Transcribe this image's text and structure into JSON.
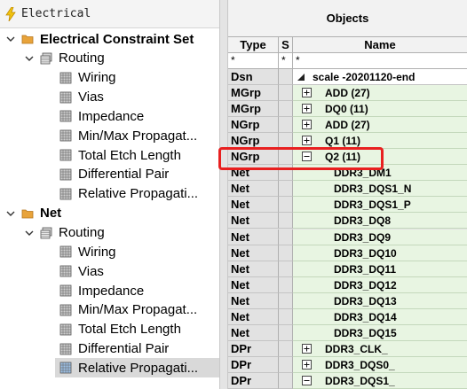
{
  "left_panel": {
    "header_title": "Electrical",
    "tree": [
      {
        "label": "Electrical Constraint Set",
        "level": 0,
        "expanded": true,
        "kind": "folder",
        "bold": true
      },
      {
        "label": "Routing",
        "level": 1,
        "expanded": true,
        "kind": "worksheet-group"
      },
      {
        "label": "Wiring",
        "level": 2,
        "kind": "worksheet"
      },
      {
        "label": "Vias",
        "level": 2,
        "kind": "worksheet"
      },
      {
        "label": "Impedance",
        "level": 2,
        "kind": "worksheet"
      },
      {
        "label": "Min/Max Propagat...",
        "level": 2,
        "kind": "worksheet"
      },
      {
        "label": "Total Etch Length",
        "level": 2,
        "kind": "worksheet"
      },
      {
        "label": "Differential Pair",
        "level": 2,
        "kind": "worksheet"
      },
      {
        "label": "Relative Propagati...",
        "level": 2,
        "kind": "worksheet"
      },
      {
        "label": "Net",
        "level": 0,
        "expanded": true,
        "kind": "folder",
        "bold": true
      },
      {
        "label": "Routing",
        "level": 1,
        "expanded": true,
        "kind": "worksheet-group"
      },
      {
        "label": "Wiring",
        "level": 2,
        "kind": "worksheet"
      },
      {
        "label": "Vias",
        "level": 2,
        "kind": "worksheet"
      },
      {
        "label": "Impedance",
        "level": 2,
        "kind": "worksheet"
      },
      {
        "label": "Min/Max Propagat...",
        "level": 2,
        "kind": "worksheet"
      },
      {
        "label": "Total Etch Length",
        "level": 2,
        "kind": "worksheet"
      },
      {
        "label": "Differential Pair",
        "level": 2,
        "kind": "worksheet"
      },
      {
        "label": "Relative Propagati...",
        "level": 2,
        "kind": "worksheet",
        "selected": true
      }
    ]
  },
  "grid": {
    "objects_header": "Objects",
    "columns": {
      "type": "Type",
      "s": "S",
      "name": "Name"
    },
    "filters": {
      "type": "*",
      "s": "*",
      "name": "*"
    },
    "rows": [
      {
        "type": "Dsn",
        "name": "scale -20201120-end",
        "indent": 0,
        "marker": "triangle"
      },
      {
        "type": "MGrp",
        "name": "ADD (27)",
        "indent": 1,
        "marker": "plus"
      },
      {
        "type": "MGrp",
        "name": "DQ0 (11)",
        "indent": 1,
        "marker": "plus"
      },
      {
        "type": "NGrp",
        "name": "ADD (27)",
        "indent": 1,
        "marker": "plus"
      },
      {
        "type": "NGrp",
        "name": "Q1 (11)",
        "indent": 1,
        "marker": "plus"
      },
      {
        "type": "NGrp",
        "name": "Q2 (11)",
        "indent": 1,
        "marker": "minus",
        "highlighted": true
      },
      {
        "type": "Net",
        "name": "DDR3_DM1",
        "indent": 2,
        "marker": "none"
      },
      {
        "type": "Net",
        "name": "DDR3_DQS1_N",
        "indent": 2,
        "marker": "none"
      },
      {
        "type": "Net",
        "name": "DDR3_DQS1_P",
        "indent": 2,
        "marker": "none"
      },
      {
        "type": "Net",
        "name": "DDR3_DQ8",
        "indent": 2,
        "marker": "none"
      },
      {
        "type": "Net",
        "name": "DDR3_DQ9",
        "indent": 2,
        "marker": "none"
      },
      {
        "type": "Net",
        "name": "DDR3_DQ10",
        "indent": 2,
        "marker": "none"
      },
      {
        "type": "Net",
        "name": "DDR3_DQ11",
        "indent": 2,
        "marker": "none"
      },
      {
        "type": "Net",
        "name": "DDR3_DQ12",
        "indent": 2,
        "marker": "none"
      },
      {
        "type": "Net",
        "name": "DDR3_DQ13",
        "indent": 2,
        "marker": "none"
      },
      {
        "type": "Net",
        "name": "DDR3_DQ14",
        "indent": 2,
        "marker": "none"
      },
      {
        "type": "Net",
        "name": "DDR3_DQ15",
        "indent": 2,
        "marker": "none"
      },
      {
        "type": "DPr",
        "name": "DDR3_CLK_",
        "indent": 1,
        "marker": "plus"
      },
      {
        "type": "DPr",
        "name": "DDR3_DQS0_",
        "indent": 1,
        "marker": "plus"
      },
      {
        "type": "DPr",
        "name": "DDR3_DQS1_",
        "indent": 1,
        "marker": "minus"
      }
    ]
  },
  "colors": {
    "highlight_box": "#e82020",
    "name_cell_bg": "#e8f5e2",
    "selected_tree_row": "#d9d9d9",
    "folder": "#e8a33a"
  }
}
